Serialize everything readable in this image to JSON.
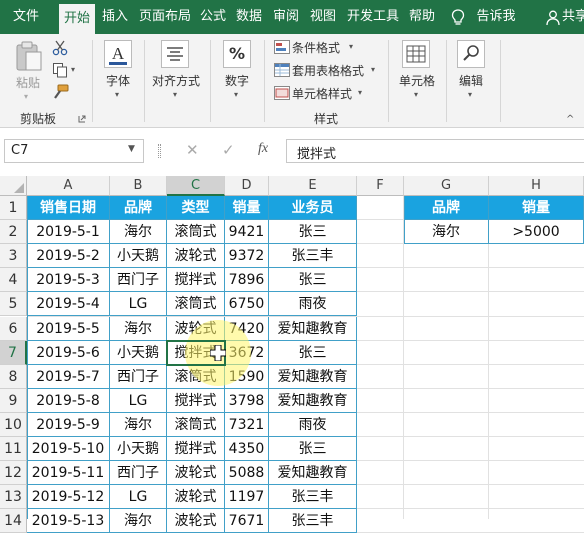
{
  "menu": {
    "tabs": [
      "文件",
      "开始",
      "插入",
      "页面布局",
      "公式",
      "数据",
      "审阅",
      "视图",
      "开发工具",
      "帮助"
    ],
    "tell_me": "告诉我",
    "share": "共享"
  },
  "ribbon": {
    "paste": "粘贴",
    "clipboard": "剪贴板",
    "font": "字体",
    "align": "对齐方式",
    "number": "数字",
    "number_symbol": "%",
    "conditional_format": "条件格式",
    "table_format": "套用表格格式",
    "cell_style": "单元格样式",
    "styles": "样式",
    "cells": "单元格",
    "editing": "编辑"
  },
  "formula_bar": {
    "name_box": "C7",
    "fx": "fx",
    "content": "搅拌式"
  },
  "columns": [
    "A",
    "B",
    "C",
    "D",
    "E",
    "F",
    "G",
    "H"
  ],
  "rows": [
    "1",
    "2",
    "3",
    "4",
    "5",
    "6",
    "7",
    "8",
    "9",
    "10",
    "11",
    "12",
    "13",
    "14"
  ],
  "table": {
    "headers": [
      "销售日期",
      "品牌",
      "类型",
      "销量",
      "业务员"
    ],
    "data": [
      [
        "2019-5-1",
        "海尔",
        "滚筒式",
        "9421",
        "张三"
      ],
      [
        "2019-5-2",
        "小天鹅",
        "波轮式",
        "9372",
        "张三丰"
      ],
      [
        "2019-5-3",
        "西门子",
        "搅拌式",
        "7896",
        "张三"
      ],
      [
        "2019-5-4",
        "LG",
        "滚筒式",
        "6750",
        "雨夜"
      ],
      [
        "2019-5-5",
        "海尔",
        "波轮式",
        "7420",
        "爱知趣教育"
      ],
      [
        "2019-5-6",
        "小天鹅",
        "搅拌式",
        "3672",
        "张三"
      ],
      [
        "2019-5-7",
        "西门子",
        "滚筒式",
        "1590",
        "爱知趣教育"
      ],
      [
        "2019-5-8",
        "LG",
        "搅拌式",
        "3798",
        "爱知趣教育"
      ],
      [
        "2019-5-9",
        "海尔",
        "滚筒式",
        "7321",
        "雨夜"
      ],
      [
        "2019-5-10",
        "小天鹅",
        "搅拌式",
        "4350",
        "张三"
      ],
      [
        "2019-5-11",
        "西门子",
        "波轮式",
        "5088",
        "爱知趣教育"
      ],
      [
        "2019-5-12",
        "LG",
        "波轮式",
        "1197",
        "张三丰"
      ],
      [
        "2019-5-13",
        "海尔",
        "波轮式",
        "7671",
        "张三丰"
      ]
    ]
  },
  "criteria": {
    "headers": [
      "品牌",
      "销量"
    ],
    "values": [
      "海尔",
      ">5000"
    ]
  },
  "colors": {
    "excel_green": "#217346",
    "header_blue": "#1aa3e0",
    "cursor_highlight": "#fff56a"
  }
}
